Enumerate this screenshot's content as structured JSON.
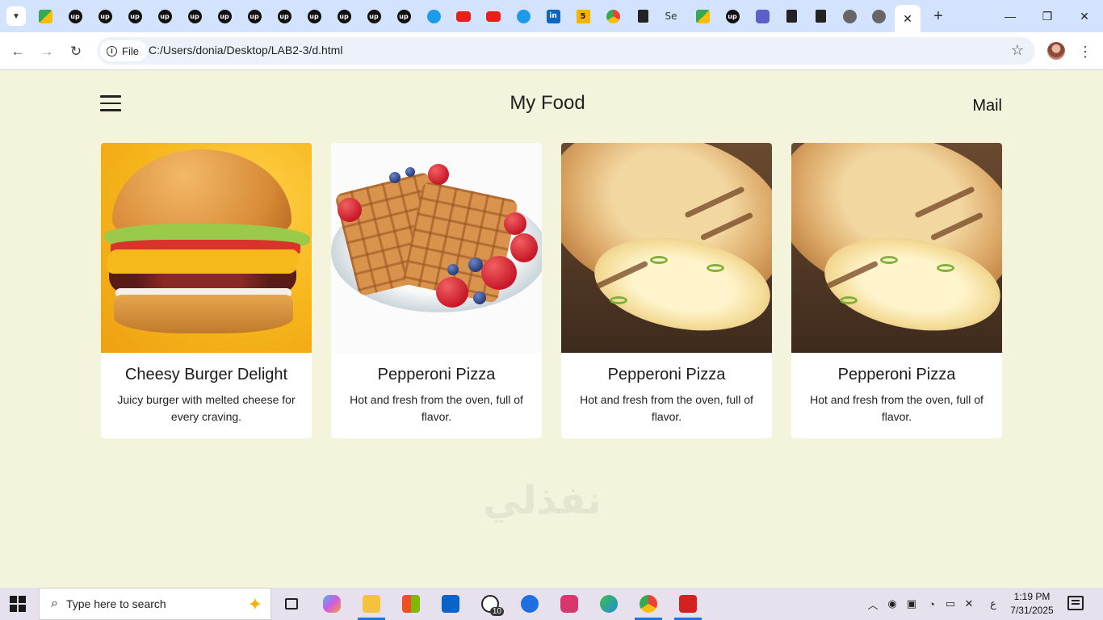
{
  "browser": {
    "tabs_favicons": [
      "google-meet",
      "upwork",
      "upwork",
      "upwork",
      "upwork",
      "upwork",
      "upwork",
      "upwork",
      "upwork",
      "upwork",
      "upwork",
      "upwork",
      "upwork",
      "blue-app",
      "youtube",
      "youtube",
      "blue-swirl",
      "linkedin",
      "five",
      "chrome",
      "doc",
      "se",
      "google-meet",
      "upwork",
      "teams",
      "doc",
      "doc",
      "globe",
      "globe"
    ],
    "se_tab_label": "Se",
    "five_tab_label": "5",
    "linkedin_label": "in",
    "upwork_label": "up",
    "close_active_tab": "✕",
    "new_tab": "+",
    "window_controls": {
      "minimize": "—",
      "restore": "❐",
      "close": "✕"
    },
    "address": {
      "chip_label": "File",
      "url": "C:/Users/donia/Desktop/LAB2-3/d.html"
    },
    "nav": {
      "back": "←",
      "forward": "→",
      "reload": "↻",
      "bookmark": "☆",
      "menu": "⋮"
    }
  },
  "page": {
    "title": "My Food",
    "mail_link": "Mail",
    "cards": [
      {
        "title": "Cheesy Burger Delight",
        "description": "Juicy burger with melted cheese for every craving.",
        "image": "burger"
      },
      {
        "title": "Pepperoni Pizza",
        "description": "Hot and fresh from the oven, full of flavor.",
        "image": "waffles-with-berries"
      },
      {
        "title": "Pepperoni Pizza",
        "description": "Hot and fresh from the oven, full of flavor.",
        "image": "grilled-wrap"
      },
      {
        "title": "Pepperoni Pizza",
        "description": "Hot and fresh from the oven, full of flavor.",
        "image": "grilled-wrap"
      }
    ],
    "watermark": "نفذلي"
  },
  "taskbar": {
    "search_placeholder": "Type here to search",
    "whatsapp_badge": "10",
    "tray_lang": "ع",
    "time": "1:19 PM",
    "date": "7/31/2025"
  }
}
